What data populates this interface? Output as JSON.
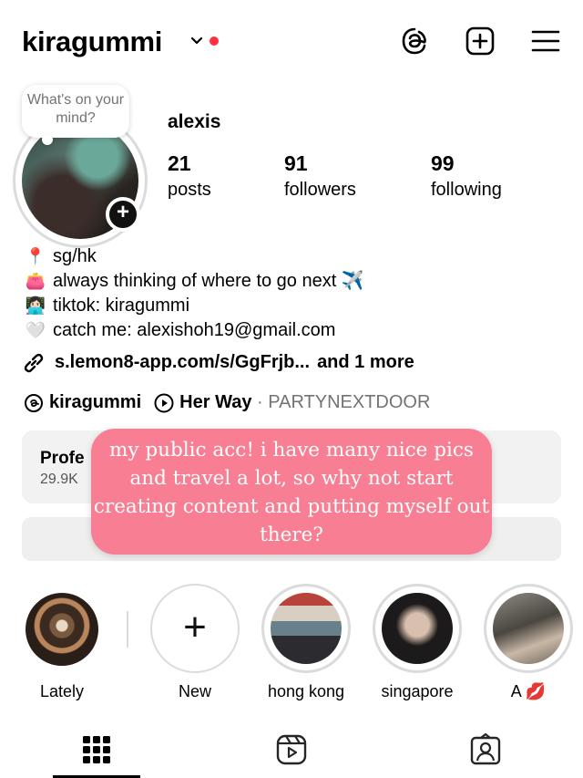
{
  "header": {
    "username": "kiragummi",
    "icons": [
      "chevron-down-icon",
      "threads-icon",
      "create-post-icon",
      "menu-icon"
    ],
    "notification_dot_color": "#ff3040"
  },
  "note": {
    "text": "What's on your mind?"
  },
  "profile": {
    "display_name": "alexis",
    "stats": [
      {
        "value": "21",
        "label": "posts"
      },
      {
        "value": "91",
        "label": "followers"
      },
      {
        "value": "99",
        "label": "following"
      }
    ]
  },
  "bio": {
    "lines": [
      {
        "emoji": "📍",
        "text": "sg/hk"
      },
      {
        "emoji": "👛",
        "text": "always thinking of where to go next ✈️"
      },
      {
        "emoji": "👩🏻‍💻",
        "text": "tiktok: kiragummi"
      },
      {
        "emoji": "🤍",
        "text": "catch me: alexishoh19@gmail.com"
      }
    ],
    "link": "s.lemon8-app.com/s/GgFrjb...",
    "link_more": "and 1 more"
  },
  "threads_line": {
    "threads_handle": "kiragummi",
    "song": "Her Way",
    "separator": "·",
    "artist": "PARTYNEXTDOOR"
  },
  "dashboard": {
    "title": "Profe",
    "subtitle": "29.9K"
  },
  "overlay_caption": {
    "lines": [
      "my public acc! i have many nice pics",
      "and travel a lot, so why not start",
      "creating content and putting myself out",
      "there?"
    ],
    "color": "#f87f93"
  },
  "highlights": [
    {
      "label": "Lately"
    },
    {
      "label": "New"
    },
    {
      "label": "hong kong"
    },
    {
      "label": "singapore"
    },
    {
      "label": "A 💋"
    }
  ],
  "tabs": [
    "grid-icon",
    "reels-icon",
    "tagged-icon"
  ]
}
